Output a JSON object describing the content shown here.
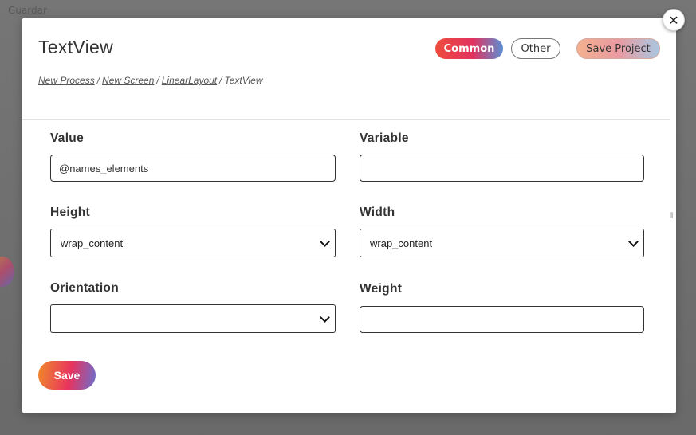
{
  "background": {
    "corner_text": "Guardar"
  },
  "modal": {
    "title": "TextView",
    "close_icon": "close-icon",
    "tabs": {
      "common_label": "Common",
      "other_label": "Other",
      "save_project_label": "Save Project"
    },
    "breadcrumb": {
      "items": [
        "New Process",
        "New Screen",
        "LinearLayout"
      ],
      "current": "TextView",
      "separator": "/"
    }
  },
  "form": {
    "value": {
      "label": "Value",
      "current_value": "@names_elements"
    },
    "variable": {
      "label": "Variable",
      "current_value": ""
    },
    "height": {
      "label": "Height",
      "selected": "wrap_content"
    },
    "width": {
      "label": "Width",
      "selected": "wrap_content"
    },
    "orientation": {
      "label": "Orientation",
      "selected": ""
    },
    "weight": {
      "label": "Weight",
      "current_value": ""
    },
    "save_label": "Save"
  },
  "colors": {
    "accent_start": "#f08a2a",
    "accent_mid": "#e8335e",
    "accent_end": "#6a6fd0"
  }
}
